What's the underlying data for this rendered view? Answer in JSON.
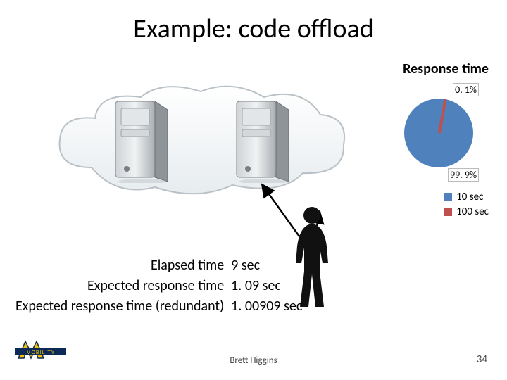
{
  "title": "Example: code offload",
  "responseTitle": "Response time",
  "pieLabelSmall": "0. 1%",
  "pieLabelLarge": "99. 9%",
  "legend": {
    "a": "10 sec",
    "b": "100 sec"
  },
  "stats": {
    "rows": [
      {
        "key": "Elapsed time",
        "val": "9 sec"
      },
      {
        "key": "Expected response time",
        "val": "1. 09 sec"
      },
      {
        "key": "Expected response time (redundant)",
        "val": "1. 00909 sec"
      }
    ]
  },
  "footerName": "Brett Higgins",
  "pageNumber": "34",
  "logoText": "MOBILITY",
  "chart_data": {
    "type": "pie",
    "title": "Response time",
    "series": [
      {
        "name": "10 sec",
        "value": 99.9
      },
      {
        "name": "100 sec",
        "value": 0.1
      }
    ]
  }
}
